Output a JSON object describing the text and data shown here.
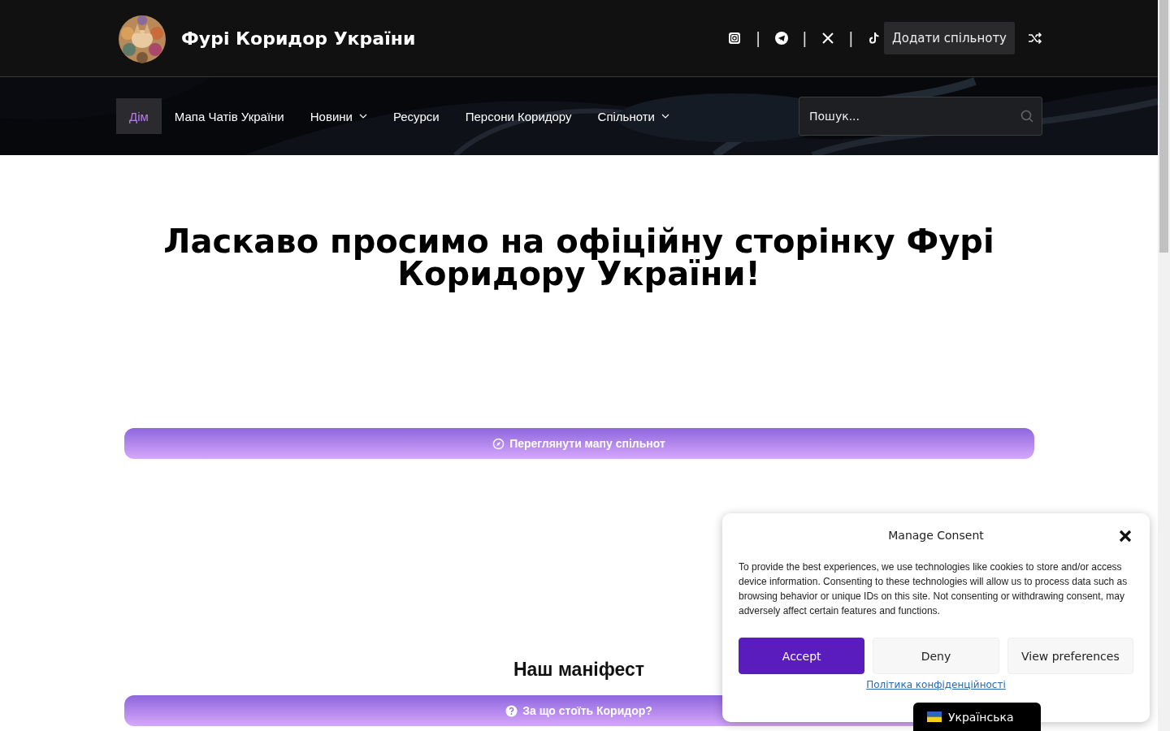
{
  "header": {
    "site_title": "Фурі Коридор України",
    "social": [
      {
        "kind": "instagram"
      },
      {
        "kind": "telegram"
      },
      {
        "kind": "x"
      },
      {
        "kind": "tiktok"
      }
    ],
    "separator": "|",
    "add_button": "Додати спільноту"
  },
  "nav": {
    "items": [
      {
        "label": "Дім",
        "selected": true,
        "dropdown": false
      },
      {
        "label": "Мапа Чатів України",
        "selected": false,
        "dropdown": false
      },
      {
        "label": "Новини",
        "selected": false,
        "dropdown": true
      },
      {
        "label": "Ресурси",
        "selected": false,
        "dropdown": false
      },
      {
        "label": "Персони Коридору",
        "selected": false,
        "dropdown": false
      },
      {
        "label": "Спільноти",
        "selected": false,
        "dropdown": true
      }
    ],
    "search": {
      "placeholder": "Пошук..."
    }
  },
  "hero": {
    "title": "Ласкаво просимо на офіційну сторінку Фурі Коридору України!"
  },
  "map_button": {
    "label": "Переглянути мапу спільнот"
  },
  "manifesto": {
    "heading": "Наш маніфест",
    "button": {
      "label": "За що стоїть Коридор?"
    }
  },
  "consent": {
    "title": "Manage Consent",
    "text": "To provide the best experiences, we use technologies like cookies to store and/or access device information. Consenting to these technologies will allow us to process data such as browsing behavior or unique IDs on this site. Not consenting or withdrawing consent, may adversely affect certain features and functions.",
    "buttons": [
      {
        "label": "Accept",
        "kind": "primary"
      },
      {
        "label": "Deny",
        "kind": "secondary"
      },
      {
        "label": "View preferences",
        "kind": "secondary"
      }
    ],
    "policy_link": "Політика конфіденційності"
  },
  "language": {
    "label": "Українська"
  }
}
